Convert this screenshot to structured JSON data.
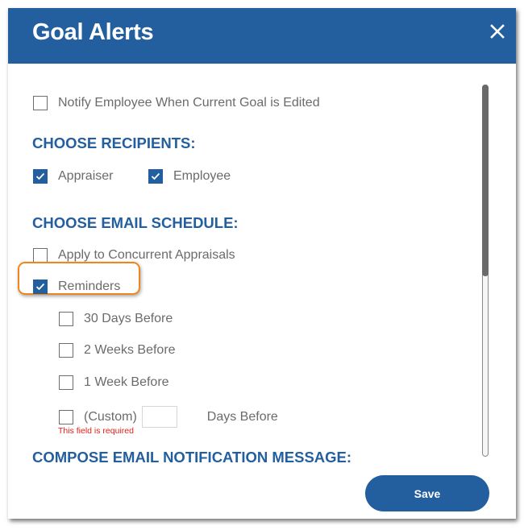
{
  "dialog": {
    "title": "Goal Alerts",
    "close_icon": "close-icon"
  },
  "options": {
    "notify_edit": {
      "label": "Notify Employee When Current Goal is Edited",
      "checked": false
    }
  },
  "recipients": {
    "heading": "CHOOSE RECIPIENTS:",
    "items": [
      {
        "label": "Appraiser",
        "checked": true
      },
      {
        "label": "Employee",
        "checked": true
      }
    ]
  },
  "schedule": {
    "heading": "CHOOSE EMAIL SCHEDULE:",
    "concurrent": {
      "label": "Apply to Concurrent Appraisals",
      "checked": false
    },
    "reminders": {
      "label": "Reminders",
      "checked": true
    },
    "reminder_options": [
      {
        "label": "30 Days Before",
        "checked": false
      },
      {
        "label": "2 Weeks Before",
        "checked": false
      },
      {
        "label": "1 Week Before",
        "checked": false
      }
    ],
    "custom": {
      "label": "(Custom)",
      "value": "",
      "suffix": "Days Before",
      "checked": false,
      "error": "This field is required"
    }
  },
  "compose": {
    "heading": "COMPOSE EMAIL NOTIFICATION MESSAGE:"
  },
  "footer": {
    "save_label": "Save"
  },
  "colors": {
    "brand": "#235f9f",
    "highlight": "#f0861b",
    "error": "#e0201b"
  }
}
